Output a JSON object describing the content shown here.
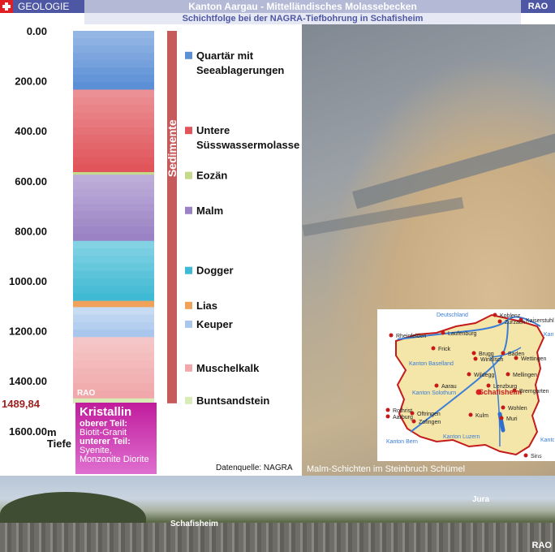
{
  "header": {
    "section_label": "GEOLOGIE",
    "title": "Kanton Aargau - Mittelländisches Molassebecken",
    "subtitle": "Schichtfolge bei der NAGRA-Tiefbohrung in Schafisheim",
    "tag": "RAO"
  },
  "chart_data": {
    "type": "bar",
    "orientation": "vertical-stack",
    "title": "Schichtfolge bei der NAGRA-Tiefbohrung in Schafisheim",
    "ylabel": "Tiefe",
    "ylabel_unit": "m",
    "ylim": [
      0,
      1600
    ],
    "y_inverted": true,
    "yticks": [
      "0.00",
      "200.00",
      "400.00",
      "600.00",
      "800.00",
      "1000.00",
      "1200.00",
      "1400.00",
      "1600.00"
    ],
    "depth_marker": "1489,84",
    "group_label": "Sedimente",
    "layers": [
      {
        "name": "Quartär mit Seeablagerungen",
        "top": 0,
        "bottom": 235,
        "color": "#5b8fd6",
        "label_depth": 100
      },
      {
        "name": "Untere Süsswassermolasse",
        "top": 235,
        "bottom": 565,
        "color": "#e0545a",
        "label_depth": 400
      },
      {
        "name": "Eozän",
        "top": 565,
        "bottom": 575,
        "color": "#c5d98a",
        "label_depth": 580
      },
      {
        "name": "Malm",
        "top": 575,
        "bottom": 840,
        "color": "#9a82c4",
        "label_depth": 720
      },
      {
        "name": "Dogger",
        "top": 840,
        "bottom": 1080,
        "color": "#3fbad4",
        "label_depth": 960
      },
      {
        "name": "Lias",
        "top": 1080,
        "bottom": 1105,
        "color": "#f0a25a",
        "label_depth": 1100
      },
      {
        "name": "Keuper",
        "top": 1105,
        "bottom": 1225,
        "color": "#a9c7ec",
        "label_depth": 1175
      },
      {
        "name": "Muschelkalk",
        "top": 1225,
        "bottom": 1470,
        "color": "#f0a8aa",
        "label_depth": 1350
      },
      {
        "name": "Buntsandstein",
        "top": 1470,
        "bottom": 1489.84,
        "color": "#d7ecb7",
        "label_depth": 1480
      }
    ],
    "basement": {
      "name": "Kristallin",
      "upper_label": "oberer Teil:",
      "upper_value": "Biotit-Granit",
      "lower_label": "unterer Teil:",
      "lower_value": "Syenite, Monzonite Diorite"
    },
    "bar_watermark": "RAO",
    "source": "Datenquelle: NAGRA"
  },
  "photo": {
    "caption": "Malm-Schichten im Steinbruch Schümel"
  },
  "map": {
    "labels": [
      "Deutschland",
      "Koblenz",
      "Zurzach",
      "Kaiserstuhl",
      "Rheinfelden",
      "Laufenburg",
      "Frick",
      "Brugg",
      "Windisch",
      "Baden",
      "Wettingen",
      "Kanton Zürich",
      "Kanton Baselland",
      "Mellingen",
      "Wildegg",
      "Lenzburg",
      "Schafisheim",
      "Aarau",
      "Bremgarten",
      "Kanton Solothurn",
      "Rothrist",
      "Aarburg",
      "Oftringen",
      "Zofingen",
      "Kulm",
      "Wohlen",
      "Muri",
      "Kanton Luzern",
      "Kanton Bern",
      "Kanton Zug",
      "Sins",
      "RAO"
    ],
    "highlight": "Schafisheim"
  },
  "panorama": {
    "labels": [
      "Jura",
      "Schafisheim"
    ],
    "tag": "RAO"
  }
}
